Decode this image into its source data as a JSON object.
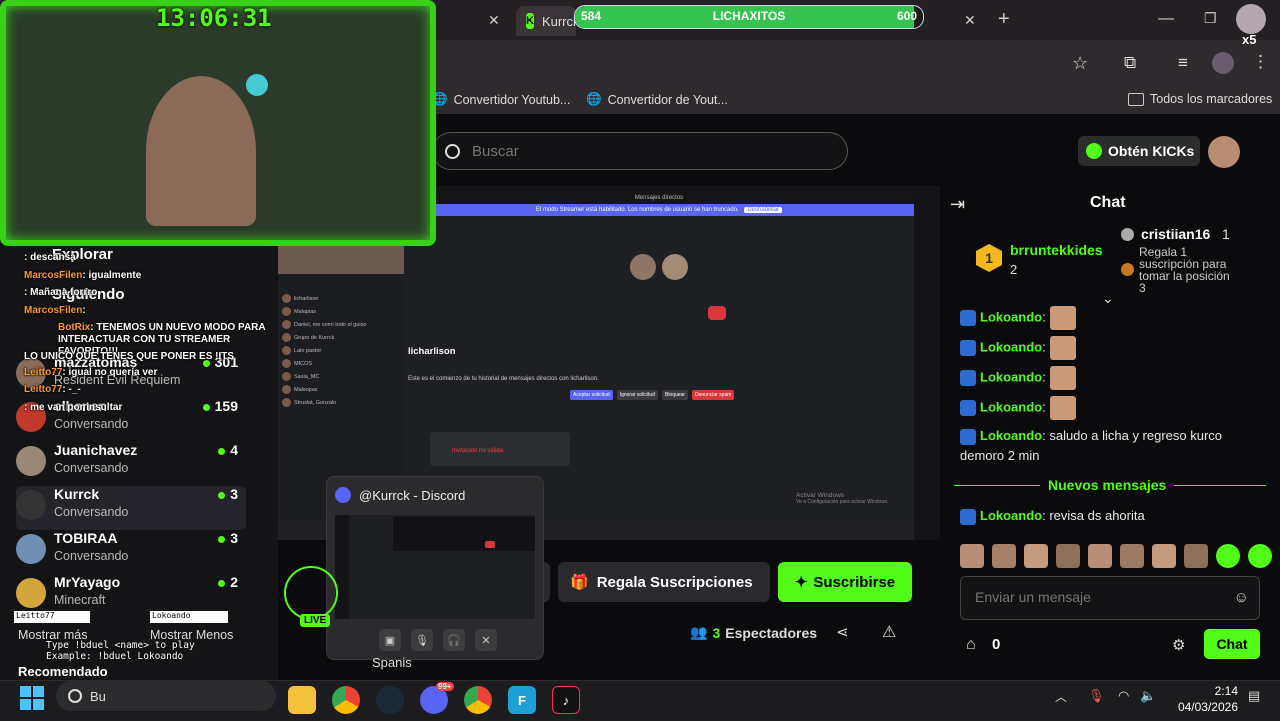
{
  "browser": {
    "tabs": [
      {
        "label": "Kurrck",
        "close": "✕"
      }
    ],
    "new_tab": "+",
    "bookmarks": [
      {
        "label": "Convertidor Youtub..."
      },
      {
        "label": "Convertidor de Yout..."
      }
    ],
    "all_bookmarks": "Todos los marcadores"
  },
  "overlay": {
    "clock": "13:06:31",
    "progress_title": "LICHAXITOS",
    "progress_current": "584",
    "progress_goal": "600",
    "progress_fraction": 0.973,
    "gift_multiplier": "x5"
  },
  "kick": {
    "search_placeholder": "Buscar",
    "get_kicks": "Obtén KICKs",
    "sidebar": {
      "explore": "Explorar",
      "following": "Siguiendo",
      "channels": [
        {
          "name": "mazzatomas",
          "sub": "Resident Evil Requiem",
          "count": "301",
          "color": "#8a6b5a"
        },
        {
          "name": "elhenen",
          "sub": "Conversando",
          "count": "159",
          "color": "#c0392b"
        },
        {
          "name": "Juanichavez",
          "sub": "Conversando",
          "count": "4",
          "color": "#9a8877"
        },
        {
          "name": "Kurrck",
          "sub": "Conversando",
          "count": "3",
          "color": "#333"
        },
        {
          "name": "TOBIRAA",
          "sub": "Conversando",
          "count": "3",
          "color": "#6f8fb3"
        },
        {
          "name": "MrYayago",
          "sub": "Minecraft",
          "count": "2",
          "color": "#d4a53a"
        }
      ],
      "show_more": "Mostrar más",
      "show_less": "Mostrar Menos",
      "recommended": "Recomendado"
    },
    "overlay_chat": [
      {
        "user": "",
        "text": ": descansa"
      },
      {
        "user": "MarcosFilen",
        "text": ": igualmente"
      },
      {
        "user": "",
        "text": ": Mañana forrro"
      },
      {
        "user": "MarcosFilen",
        "text": ":"
      },
      {
        "user": "BotRix",
        "text": ": TENEMOS UN NUEVO MODO PARA INTERACTUAR CON TU STREAMER FAVORITO!!!"
      },
      {
        "user": "",
        "text": "LO UNICO QUE TENES QUE PONER ES !ITS"
      },
      {
        "user": "Leitto77",
        "text": ": igual no quería ver"
      },
      {
        "user": "Leitto77",
        "text": ": -_-"
      },
      {
        "user": "",
        "text": ": me van por insultar"
      }
    ],
    "duel_help": [
      "Type !bduel <name> to play",
      "Example: !bduel Lokoando"
    ],
    "duel_left": "Leitto77",
    "duel_right": "Lokoando",
    "live_badge": "LIVE",
    "language": "Spanis",
    "gift_subs": "Regala Suscripciones",
    "subscribe": "Suscribirse",
    "viewers_count": "3",
    "viewers_label": "Espectadores"
  },
  "discord_popup": {
    "title": "@Kurrck - Discord"
  },
  "discord_window": {
    "header": "Mensajes directos",
    "notice": "El modo Streamer está habilitado. Los nombres de usuario se han truncado.",
    "notice_btn": "Deshabilitar",
    "profile_name": "licharlison",
    "intro": "Este es el comienzo de tu historial de mensajes directos con licharlison.",
    "buttons": [
      "Aceptar solicitud",
      "Ignorar solicitud",
      "Bloquear",
      "Denunciar spam"
    ],
    "invite_title": "Invitación no válida",
    "dm_list": [
      "licharlison",
      "Malapias",
      "Daniel, me comí todo el guiso",
      "Grupo de Kurrck",
      "Lalo pastor",
      "MICOS",
      "Sasia_MC",
      "Malsopas",
      "Struslat, Gonzalo"
    ],
    "activate_windows": "Activar Windows",
    "activate_sub": "Ve a Configuración para activar Windows."
  },
  "chat": {
    "title": "Chat",
    "leaderboard": [
      {
        "rank": "1",
        "name": "brruntekkides",
        "count": "2"
      },
      {
        "rank": "",
        "name": "cristiian16",
        "count": "1"
      }
    ],
    "gift_note": "Regala 1 suscripción para tomar la posición 3",
    "messages": [
      {
        "user": "Lokoando",
        "text": ":",
        "emote": true
      },
      {
        "user": "Lokoando",
        "text": ":",
        "emote": true
      },
      {
        "user": "Lokoando",
        "text": ":",
        "emote": true
      },
      {
        "user": "Lokoando",
        "text": ":",
        "emote": true
      },
      {
        "user": "Lokoando",
        "text": ": saludo a licha y regreso kurco demoro 2 min",
        "emote": false
      }
    ],
    "new_messages": "Nuevos mensajes",
    "last_message": {
      "user": "Lokoando",
      "text": ": revisa ds ahorita"
    },
    "input_placeholder": "Enviar un mensaje",
    "points": "0",
    "send": "Chat"
  },
  "taskbar": {
    "search_text": "Bu",
    "time": "2:14",
    "date": "04/03/2026",
    "discord_badge": "99+"
  },
  "colors": {
    "kick_green": "#53fc18",
    "overlay_green": "#3ad01a",
    "discord_blurple": "#5865f2",
    "chrome_bg": "#2e2a2d"
  }
}
